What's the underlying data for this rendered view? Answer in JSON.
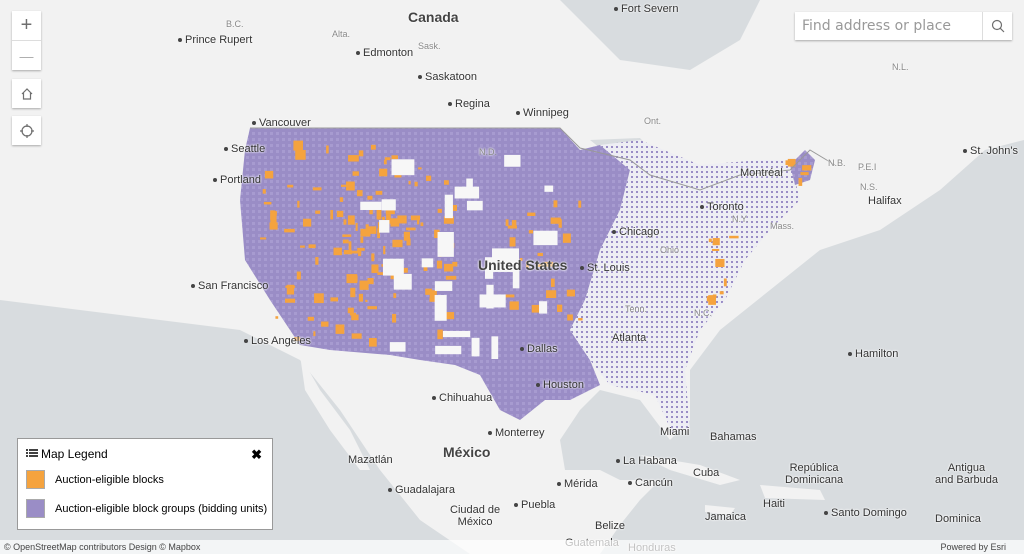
{
  "map": {
    "colors": {
      "water": "#d8dcdf",
      "land": "#f2f2f2",
      "blocks": "#f5a33e",
      "block_groups": "#9a8dc6"
    },
    "labels": [
      {
        "text": "Canada",
        "kind": "big"
      },
      {
        "text": "México",
        "kind": "big"
      },
      {
        "text": "United States",
        "kind": "big"
      },
      {
        "text": "B.C.",
        "kind": "prov"
      },
      {
        "text": "Alta.",
        "kind": "prov"
      },
      {
        "text": "Sask.",
        "kind": "prov"
      },
      {
        "text": "Ont.",
        "kind": "prov"
      },
      {
        "text": "N.D.",
        "kind": "prov"
      },
      {
        "text": "N.B.",
        "kind": "prov"
      },
      {
        "text": "P.E.I",
        "kind": "prov"
      },
      {
        "text": "N.S.",
        "kind": "prov"
      },
      {
        "text": "N.Y.",
        "kind": "prov"
      },
      {
        "text": "Mass.",
        "kind": "prov"
      },
      {
        "text": "Ohio",
        "kind": "prov"
      },
      {
        "text": "Tenn.",
        "kind": "prov"
      },
      {
        "text": "N.C.",
        "kind": "prov"
      },
      {
        "text": "N.L.",
        "kind": "prov"
      },
      {
        "text": "Fort Severn",
        "kind": "city"
      },
      {
        "text": "Prince Rupert",
        "kind": "city"
      },
      {
        "text": "Edmonton",
        "kind": "city"
      },
      {
        "text": "Saskatoon",
        "kind": "city"
      },
      {
        "text": "Regina",
        "kind": "city"
      },
      {
        "text": "Winnipeg",
        "kind": "city"
      },
      {
        "text": "Vancouver",
        "kind": "city"
      },
      {
        "text": "Seattle",
        "kind": "city"
      },
      {
        "text": "Portland",
        "kind": "city"
      },
      {
        "text": "San Francisco",
        "kind": "city"
      },
      {
        "text": "Los Angeles",
        "kind": "city"
      },
      {
        "text": "Chihuahua",
        "kind": "city"
      },
      {
        "text": "Monterrey",
        "kind": "city"
      },
      {
        "text": "Mazatlán",
        "kind": "plain"
      },
      {
        "text": "Guadalajara",
        "kind": "city"
      },
      {
        "text": "Puebla",
        "kind": "city"
      },
      {
        "text": "Ciudad de\nMéxico",
        "kind": "plain"
      },
      {
        "text": "Mérida",
        "kind": "city"
      },
      {
        "text": "Cancún",
        "kind": "city"
      },
      {
        "text": "La Habana",
        "kind": "city"
      },
      {
        "text": "Cuba",
        "kind": "plain"
      },
      {
        "text": "Bahamas",
        "kind": "plain"
      },
      {
        "text": "Miami",
        "kind": "plain"
      },
      {
        "text": "Houston",
        "kind": "city"
      },
      {
        "text": "Dallas",
        "kind": "city"
      },
      {
        "text": "Atlanta",
        "kind": "plain"
      },
      {
        "text": "Chicago",
        "kind": "city"
      },
      {
        "text": "St. Louis",
        "kind": "city"
      },
      {
        "text": "Toronto",
        "kind": "city"
      },
      {
        "text": "Montréal",
        "kind": "plain"
      },
      {
        "text": "Halifax",
        "kind": "plain"
      },
      {
        "text": "St. John's",
        "kind": "city"
      },
      {
        "text": "Hamilton",
        "kind": "city"
      },
      {
        "text": "Jamaica",
        "kind": "plain"
      },
      {
        "text": "Haiti",
        "kind": "plain"
      },
      {
        "text": "Santo Domingo",
        "kind": "city"
      },
      {
        "text": "República\nDominicana",
        "kind": "plain"
      },
      {
        "text": "Antigua\nand Barbuda",
        "kind": "plain"
      },
      {
        "text": "Dominica",
        "kind": "plain"
      },
      {
        "text": "Belize",
        "kind": "plain"
      },
      {
        "text": "Guatemala",
        "kind": "plain"
      },
      {
        "text": "Honduras",
        "kind": "plain"
      }
    ]
  },
  "controls": {
    "zoom_in": "+",
    "zoom_out": "—",
    "home_icon": "home-icon",
    "locate_icon": "locate-icon"
  },
  "search": {
    "placeholder": "Find address or place",
    "icon": "search-icon"
  },
  "legend": {
    "title": "Map Legend",
    "close": "✖",
    "items": [
      {
        "label": "Auction-eligible blocks",
        "color": "#f5a33e"
      },
      {
        "label": "Auction-eligible block groups (bidding units)",
        "color": "#9a8dc6"
      }
    ]
  },
  "attribution": {
    "left": "© OpenStreetMap contributors Design © Mapbox",
    "right": "Powered by Esri"
  }
}
